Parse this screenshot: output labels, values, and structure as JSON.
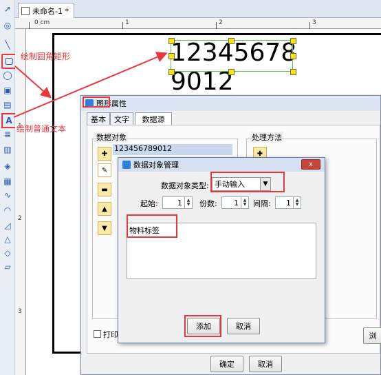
{
  "document_tab": {
    "title": "未命名-1 *"
  },
  "ruler": {
    "h_labels": [
      "0 cm",
      "1",
      "2",
      "3"
    ],
    "v_labels": [
      "1",
      "2",
      "3"
    ]
  },
  "canvas": {
    "barcode_text": "12345678\n9012"
  },
  "annotations": {
    "rounded_rect": "绘制圆角矩形",
    "plain_text": "绘制普通文本"
  },
  "graphic_properties": {
    "title": "图形属性",
    "tabs": [
      "基本",
      "文字",
      "数据源"
    ],
    "data_objects_label": "数据对象",
    "data_object_item": "123456789012",
    "processing_label": "处理方法",
    "print_label": "打印",
    "ok": "确定",
    "cancel": "取消",
    "browse": "浏"
  },
  "data_object_manager": {
    "title": "数据对象管理",
    "type_label": "数据对象类型:",
    "type_value": "手动输入",
    "start_label": "起始:",
    "start_value": "1",
    "copies_label": "份数:",
    "copies_value": "1",
    "interval_label": "间隔:",
    "interval_value": "1",
    "text_value": "物料标签",
    "add": "添加",
    "cancel": "取消",
    "close": "x"
  },
  "colors": {
    "annotation": "#e8383d",
    "selection": "#5cc04f",
    "handle": "#ffe600"
  }
}
